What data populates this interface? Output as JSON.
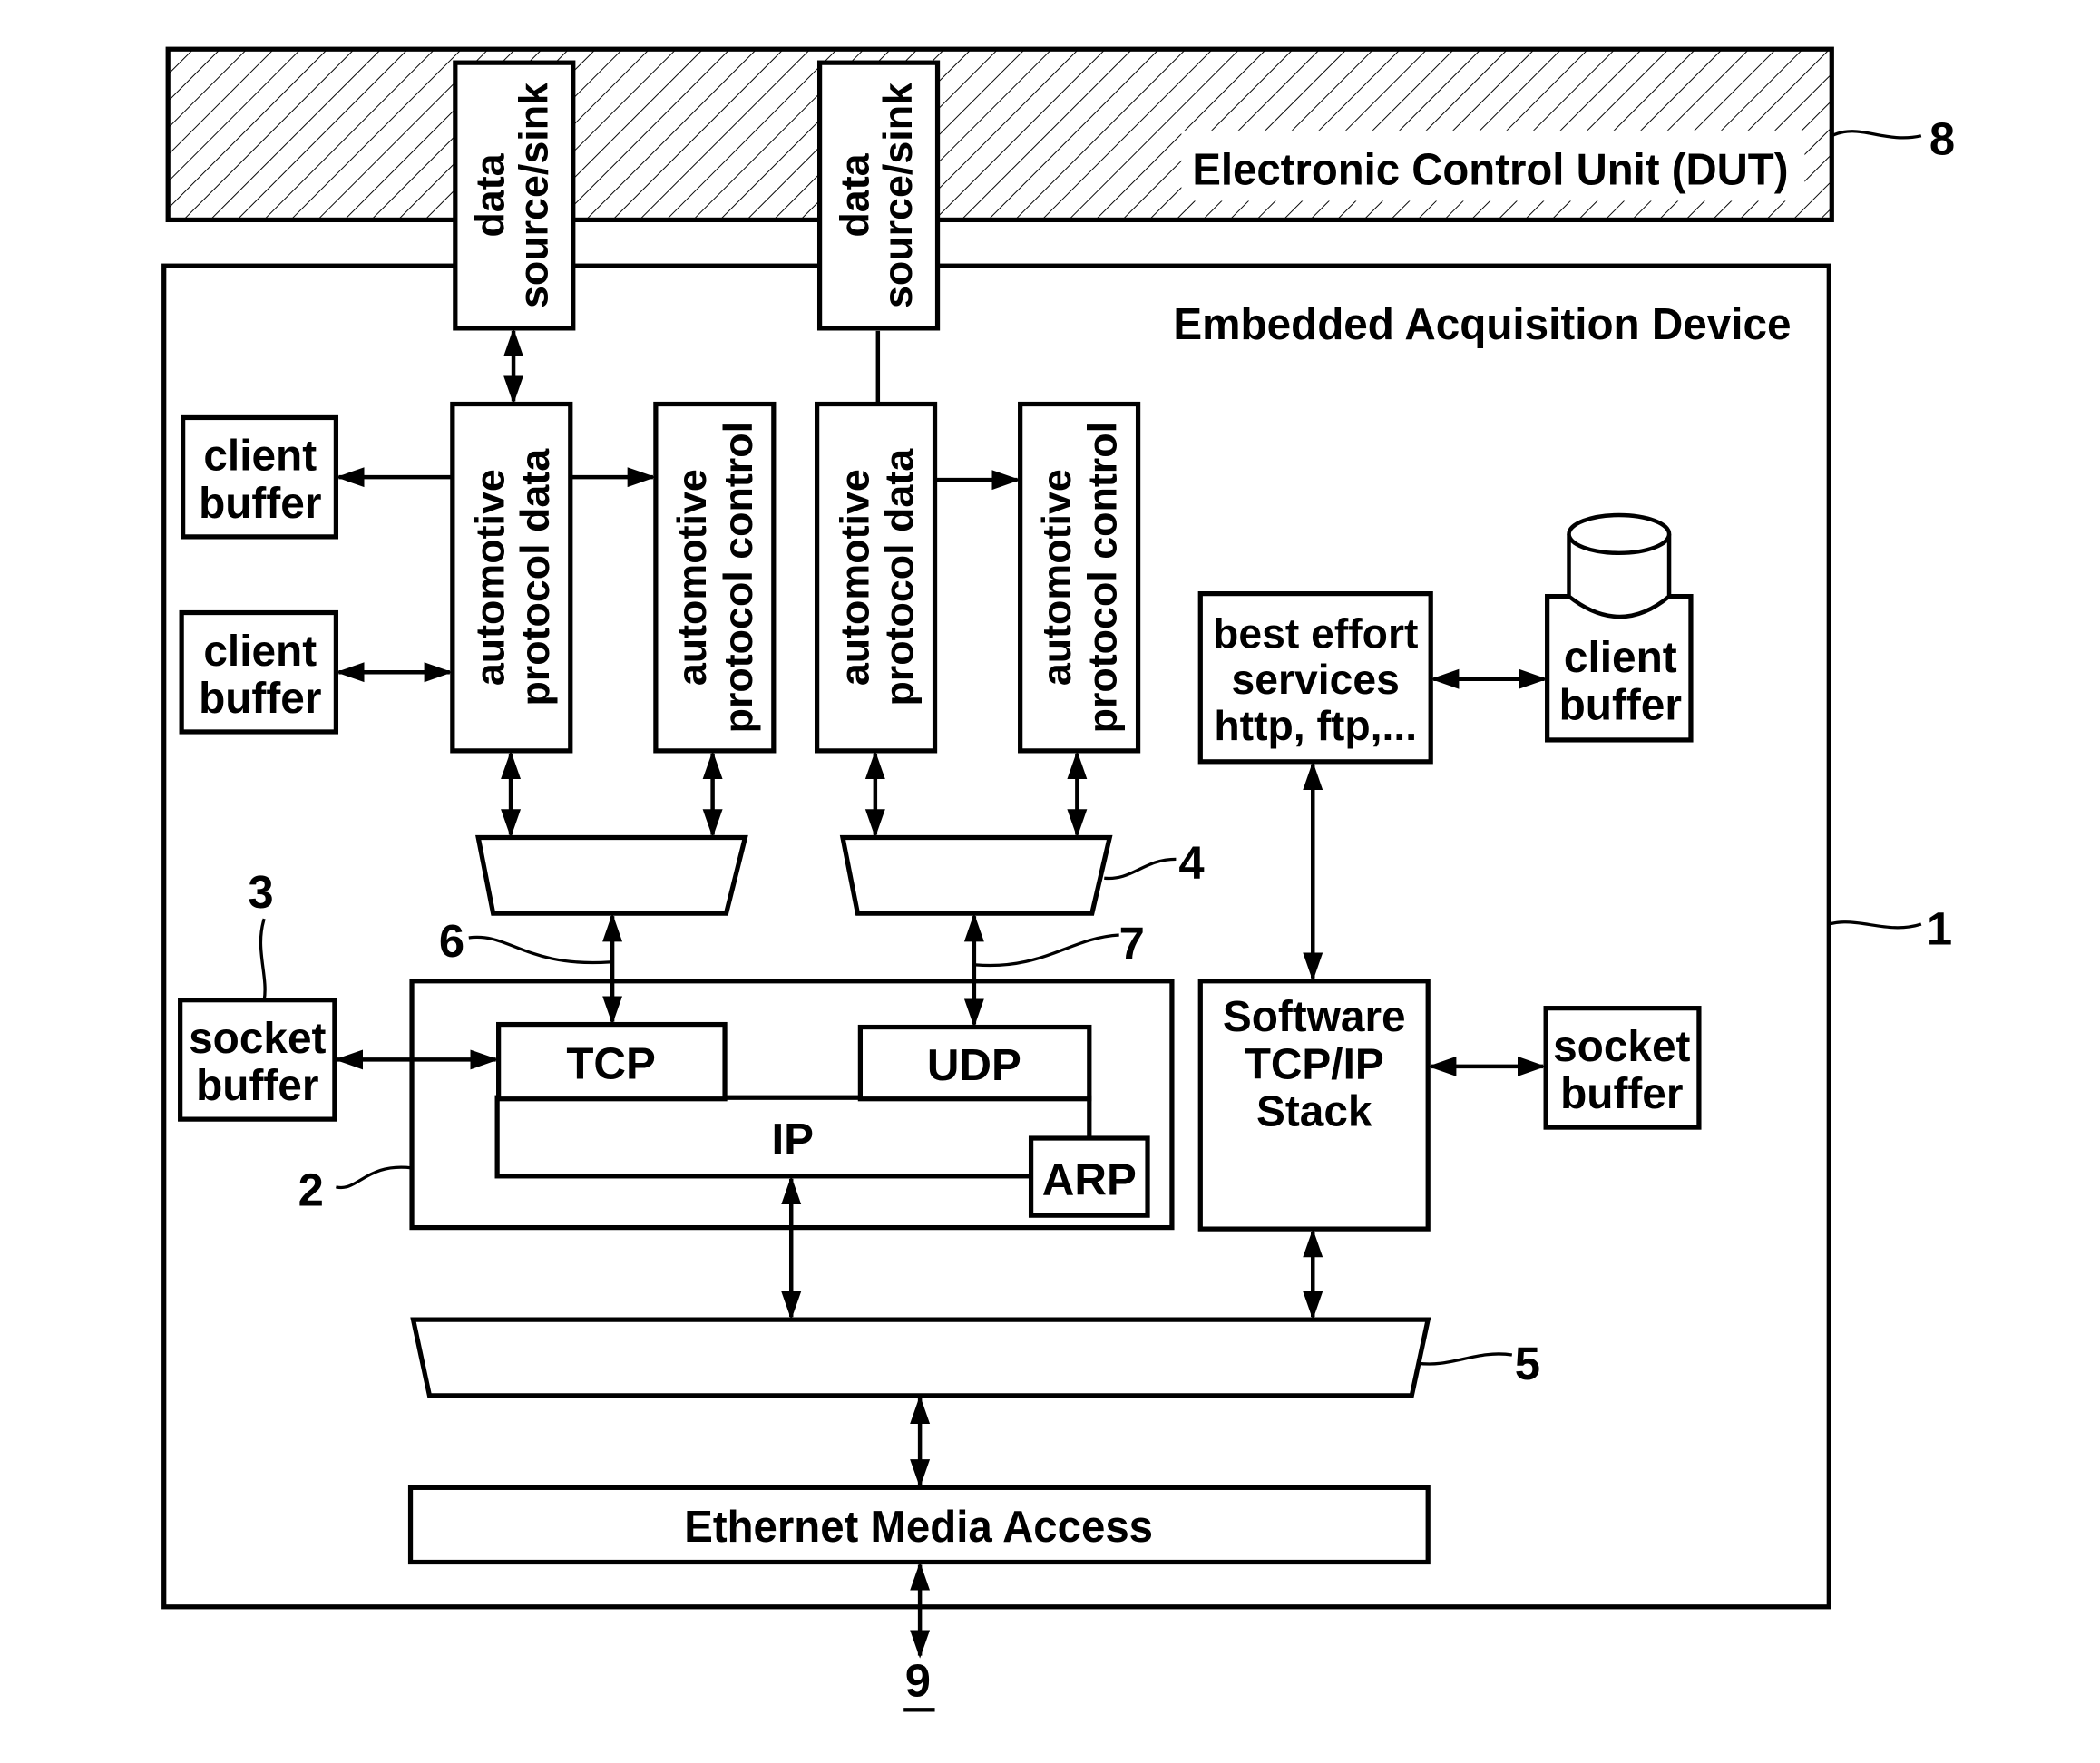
{
  "figure": {
    "ecu": {
      "label": "Electronic Control Unit (DUT)",
      "ref": "8"
    },
    "device": {
      "label": "Embedded Acquisition Device",
      "ref": "1"
    },
    "data_source_sink": [
      {
        "line1": "data",
        "line2": "source/sink"
      },
      {
        "line1": "data",
        "line2": "source/sink"
      }
    ],
    "protocol_data": [
      {
        "line1": "automotive",
        "line2": "protocol data"
      },
      {
        "line1": "automotive",
        "line2": "protocol data"
      }
    ],
    "protocol_control": [
      {
        "line1": "automotive",
        "line2": "protocol control"
      },
      {
        "line1": "automotive",
        "line2": "protocol control"
      }
    ],
    "client_buffers": [
      {
        "line1": "client",
        "line2": "buffer"
      },
      {
        "line1": "client",
        "line2": "buffer"
      },
      {
        "line1": "client",
        "line2": "buffer"
      }
    ],
    "best_effort": {
      "line1": "best effort",
      "line2": "services",
      "line3": "http, ftp,..."
    },
    "socket_buffers": [
      {
        "line1": "socket",
        "line2": "buffer",
        "ref": "3"
      },
      {
        "line1": "socket",
        "line2": "buffer"
      }
    ],
    "hw_stack": {
      "tcp": "TCP",
      "udp": "UDP",
      "ip": "IP",
      "arp": "ARP",
      "ref": "2"
    },
    "sw_stack": {
      "line1": "Software",
      "line2": "TCP/IP",
      "line3": "Stack"
    },
    "mux_refs": {
      "upper": "4",
      "lower": "5",
      "tcp_link": "6",
      "udp_link": "7"
    },
    "ethernet": {
      "label": "Ethernet Media Access",
      "ref": "9"
    }
  }
}
